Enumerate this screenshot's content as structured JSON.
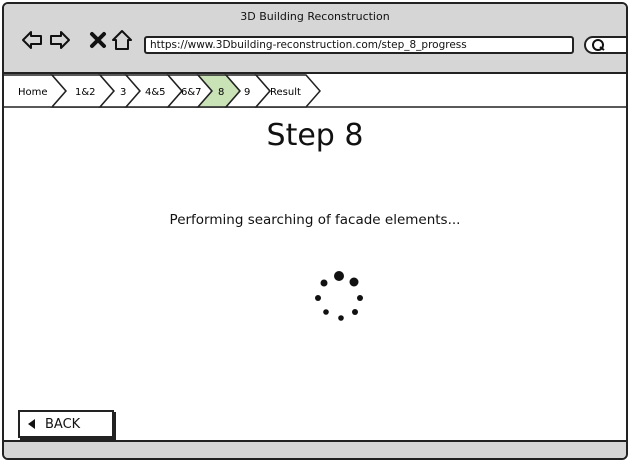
{
  "window": {
    "title": "3D Building Reconstruction"
  },
  "browser": {
    "url": "https://www.3Dbuilding-reconstruction.com/step_8_progress",
    "search_icon": "search-icon",
    "nav_icons": [
      "back-arrow-icon",
      "forward-arrow-icon",
      "close-icon",
      "home-icon"
    ]
  },
  "breadcrumb": {
    "items": [
      "Home",
      "1&2",
      "3",
      "4&5",
      "6&7",
      "8",
      "9",
      "Result"
    ],
    "active_index": 5,
    "active_color": "#c9e3b7"
  },
  "main": {
    "title": "Step 8",
    "status": "Performing searching of facade elements...",
    "spinner_icon": "loading-spinner-icon"
  },
  "footer": {
    "back_label": "BACK"
  }
}
